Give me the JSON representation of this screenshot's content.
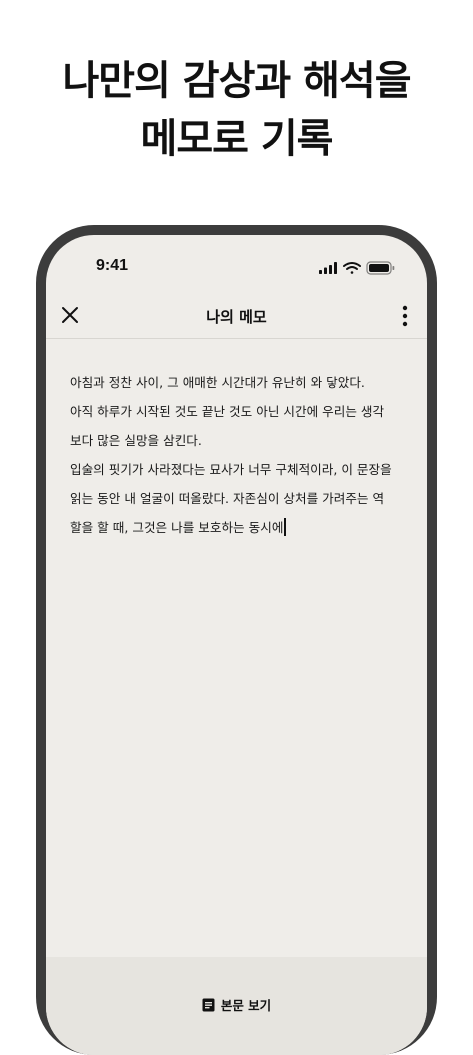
{
  "headline": {
    "line1": "나만의 감상과 해석을",
    "line2": "메모로 기록"
  },
  "status_bar": {
    "time": "9:41",
    "icons": [
      "cellular-signal-icon",
      "wifi-icon",
      "battery-icon"
    ]
  },
  "nav": {
    "title": "나의 메모",
    "close_icon": "close-icon",
    "more_icon": "more-vertical-icon"
  },
  "memo": {
    "lines": [
      "아침과 정찬 사이, 그 애매한 시간대가 유난히 와 닿았다.",
      "아직 하루가 시작된 것도 끝난 것도 아닌 시간에 우리는 생각",
      "보다 많은 실망을 삼킨다.",
      "입술의 핏기가 사라졌다는 묘사가 너무 구체적이라, 이 문장을",
      "읽는 동안 내 얼굴이 떠올랐다. 자존심이 상처를 가려주는 역",
      "할을 할 때, 그것은 나를 보호하는 동시에"
    ]
  },
  "bottom": {
    "view_text_label": "본문 보기",
    "icon": "document-icon"
  },
  "colors": {
    "screen_bg": "#efede9",
    "bottom_bar_bg": "#e6e4df",
    "phone_frame": "#3c3c3c"
  }
}
